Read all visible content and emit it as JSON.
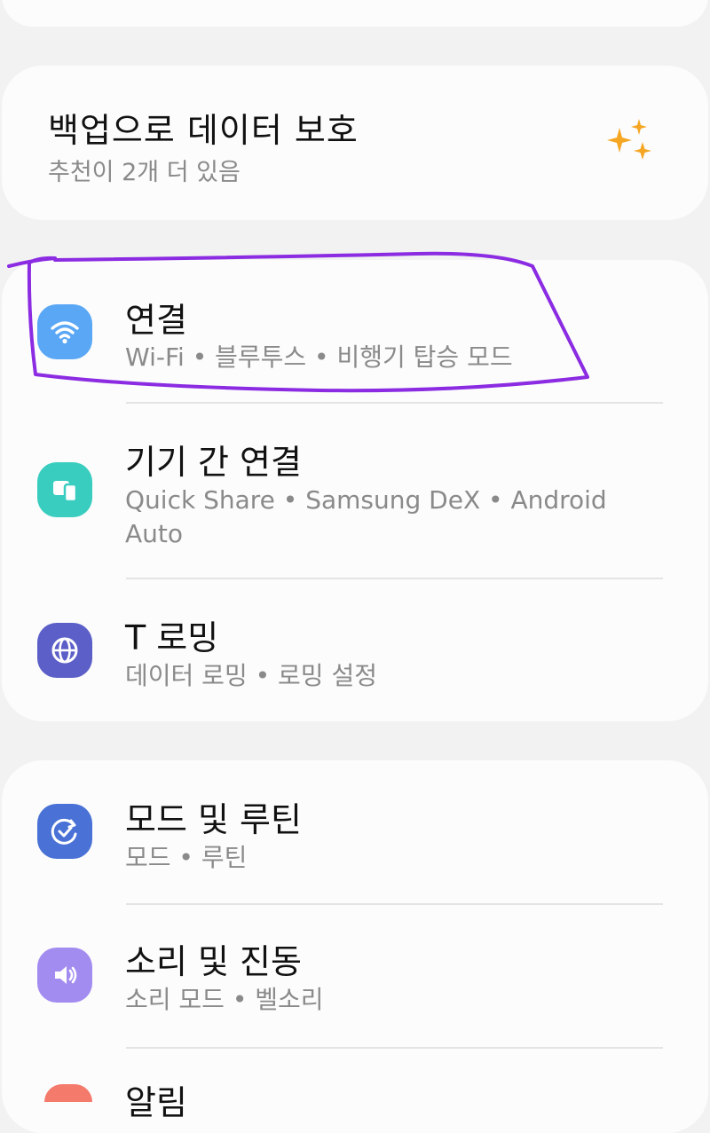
{
  "backup": {
    "title": "백업으로 데이터 보호",
    "subtitle": "추천이 2개 더 있음",
    "icon": "sparkle-icon",
    "icon_color": "#f5a623"
  },
  "settings_groups": [
    {
      "items": [
        {
          "title": "연결",
          "subtitle": "Wi-Fi  •  블루투스  •  비행기 탑승 모드",
          "icon": "wifi-icon",
          "icon_color": "#5aa7f5"
        },
        {
          "title": "기기 간 연결",
          "subtitle": "Quick Share  •  Samsung DeX  •  Android Auto",
          "icon": "devices-icon",
          "icon_color": "#39cdbf"
        },
        {
          "title": "T 로밍",
          "subtitle": "데이터 로밍  •  로밍 설정",
          "icon": "globe-icon",
          "icon_color": "#5b5fc7"
        }
      ]
    },
    {
      "items": [
        {
          "title": "모드 및 루틴",
          "subtitle": "모드  •  루틴",
          "icon": "modes-routines-icon",
          "icon_color": "#4a72d6"
        },
        {
          "title": "소리 및 진동",
          "subtitle": "소리 모드  •  벨소리",
          "icon": "speaker-icon",
          "icon_color": "#a38cf0"
        },
        {
          "title": "알림",
          "subtitle": "",
          "icon": "notification-icon",
          "icon_color": "#f47a6b"
        }
      ]
    }
  ],
  "annotation": {
    "type": "hand-drawn-outline",
    "color": "#8b2be2",
    "target": "연결"
  }
}
